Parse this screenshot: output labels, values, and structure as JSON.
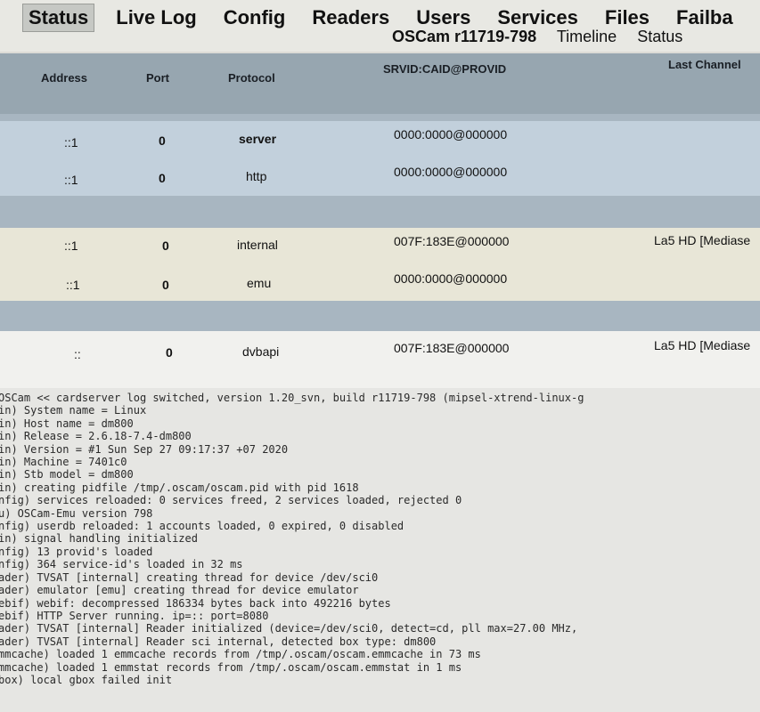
{
  "nav": {
    "tabs": [
      "Status",
      "Live Log",
      "Config",
      "Readers",
      "Users",
      "Services",
      "Files",
      "Failba"
    ],
    "active": "Status"
  },
  "subnav": {
    "version": "OSCam r11719-798",
    "timeline": "Timeline",
    "status": "Status"
  },
  "table": {
    "headers": {
      "address": "Address",
      "port": "Port",
      "protocol": "Protocol",
      "srvid": "SRVID:CAID@PROVID",
      "last_channel": "Last Channel"
    },
    "rows": [
      {
        "address": "::1",
        "port": "0",
        "protocol": "server",
        "srvid": "0000:0000@000000",
        "last_channel": ""
      },
      {
        "address": "::1",
        "port": "0",
        "protocol": "http",
        "srvid": "0000:0000@000000",
        "last_channel": ""
      },
      {
        "address": "::1",
        "port": "0",
        "protocol": "internal",
        "srvid": "007F:183E@000000",
        "last_channel": "La5 HD [Mediase"
      },
      {
        "address": "::1",
        "port": "0",
        "protocol": "emu",
        "srvid": "0000:0000@000000",
        "last_channel": ""
      },
      {
        "address": "::",
        "port": "0",
        "protocol": "dvbapi",
        "srvid": "007F:183E@000000",
        "last_channel": "La5 HD [Mediase"
      }
    ]
  },
  "log": {
    "lines": [
      "OSCam << cardserver log switched, version 1.20_svn, build r11719-798 (mipsel-xtrend-linux-g",
      "in) System name = Linux",
      "in) Host name = dm800",
      "in) Release = 2.6.18-7.4-dm800",
      "in) Version = #1 Sun Sep 27 09:17:37 +07 2020",
      "in) Machine = 7401c0",
      "in) Stb model = dm800",
      "in) creating pidfile /tmp/.oscam/oscam.pid with pid 1618",
      "nfig) services reloaded: 0 services freed, 2 services loaded, rejected 0",
      "u) OSCam-Emu version 798",
      "nfig) userdb reloaded: 1 accounts loaded, 0 expired, 0 disabled",
      "in) signal handling initialized",
      "nfig) 13 provid's loaded",
      "nfig) 364 service-id's loaded in 32 ms",
      "ader) TVSAT [internal] creating thread for device /dev/sci0",
      "ader) emulator [emu] creating thread for device emulator",
      "ebif) webif: decompressed 186334 bytes back into 492216 bytes",
      "ebif) HTTP Server running. ip=:: port=8080",
      "ader) TVSAT [internal] Reader initialized (device=/dev/sci0, detect=cd, pll max=27.00 MHz,",
      "ader) TVSAT [internal] Reader sci internal, detected box type: dm800",
      "mmcache) loaded 1 emmcache records from /tmp/.oscam/oscam.emmcache in 73 ms",
      "mmcache) loaded 1 emmstat records from /tmp/.oscam/oscam.emmstat in 1 ms",
      "box) local gbox failed init"
    ]
  }
}
